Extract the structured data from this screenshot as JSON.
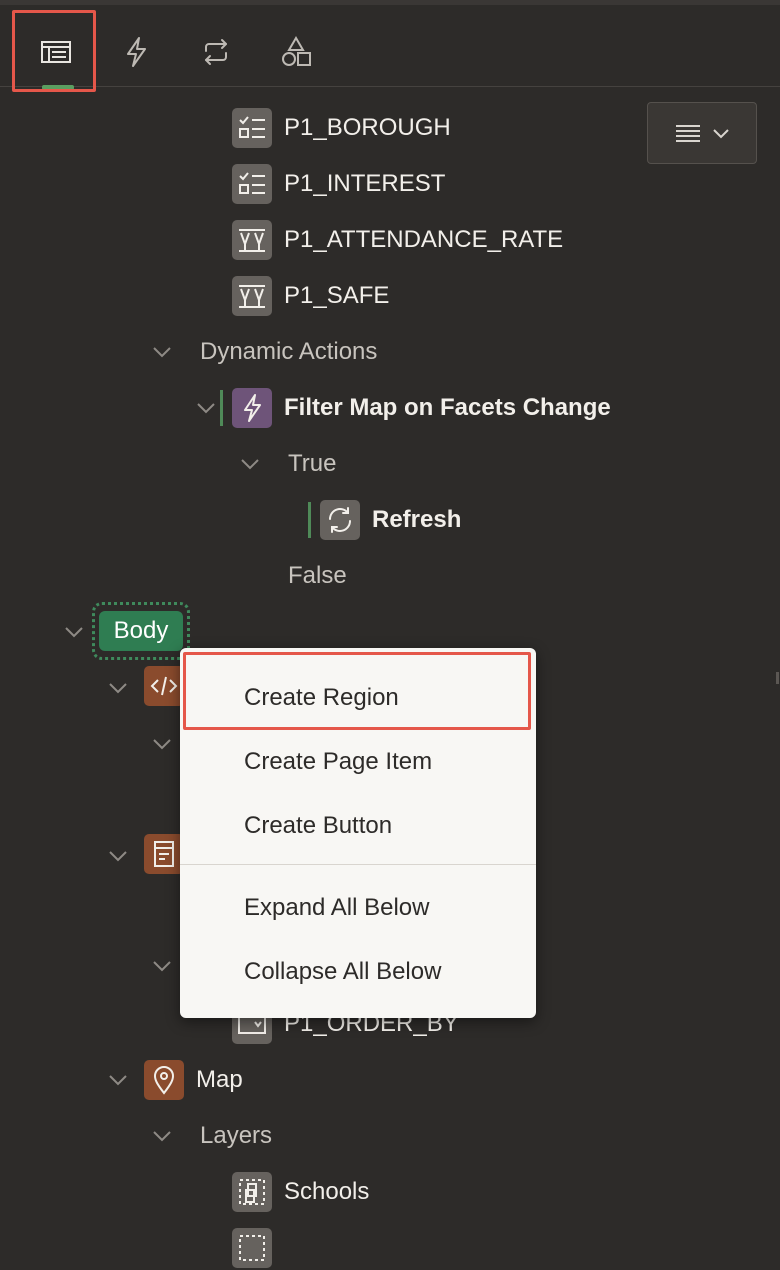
{
  "toolbar": {
    "tabs": [
      {
        "name": "rendering-tab",
        "icon": "layout-icon",
        "active": true
      },
      {
        "name": "dynamic-actions-tab",
        "icon": "lightning-icon",
        "active": false
      },
      {
        "name": "processing-tab",
        "icon": "refresh-arrows-icon",
        "active": false
      },
      {
        "name": "shared-components-tab",
        "icon": "shapes-icon",
        "active": false
      }
    ],
    "menu_button_icon": "hamburger-menu-icon"
  },
  "tree": {
    "items": {
      "borough": "P1_BOROUGH",
      "interest": "P1_INTEREST",
      "attendance": "P1_ATTENDANCE_RATE",
      "safe": "P1_SAFE"
    },
    "dynamic_actions": "Dynamic Actions",
    "filter_action": "Filter Map on Facets Change",
    "true_label": "True",
    "refresh": "Refresh",
    "false_label": "False",
    "body": "Body",
    "order_by": "P1_ORDER_BY",
    "map": "Map",
    "layers": "Layers",
    "schools": "Schools"
  },
  "context_menu": {
    "items": [
      "Create Region",
      "Create Page Item",
      "Create Button",
      "Expand All Below",
      "Collapse All Below"
    ]
  },
  "colors": {
    "background": "#2d2b29",
    "highlight": "#e5574a",
    "body_badge": "#2f7d52",
    "active_tab_underline": "#5a9e60"
  }
}
